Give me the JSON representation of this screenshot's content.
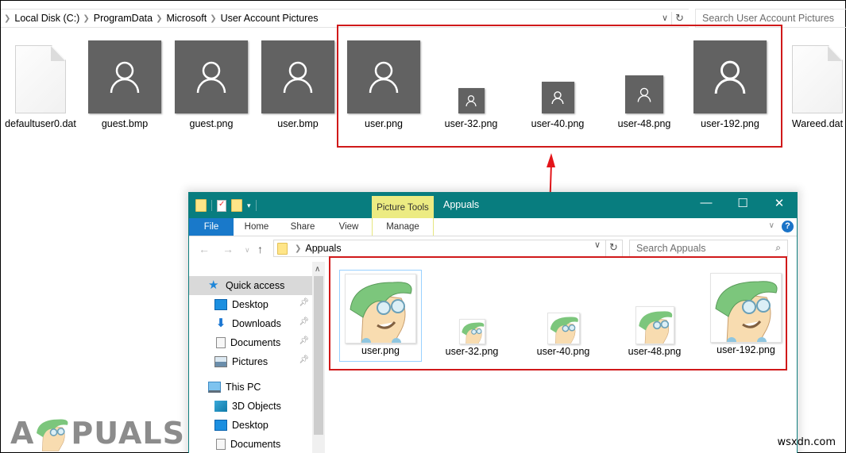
{
  "background_explorer": {
    "breadcrumb": [
      "Local Disk (C:)",
      "ProgramData",
      "Microsoft",
      "User Account Pictures"
    ],
    "search_placeholder": "Search User Account Pictures",
    "files": [
      {
        "name": "defaultuser0.dat",
        "type": "document"
      },
      {
        "name": "guest.bmp",
        "type": "avatar"
      },
      {
        "name": "guest.png",
        "type": "avatar"
      },
      {
        "name": "user.bmp",
        "type": "avatar"
      },
      {
        "name": "user.png",
        "type": "avatar"
      },
      {
        "name": "user-32.png",
        "type": "avatar"
      },
      {
        "name": "user-40.png",
        "type": "avatar"
      },
      {
        "name": "user-48.png",
        "type": "avatar"
      },
      {
        "name": "user-192.png",
        "type": "avatar"
      },
      {
        "name": "Wareed.dat",
        "type": "document"
      }
    ]
  },
  "window": {
    "title": "Appuals",
    "contextual_tab_group": "Picture Tools",
    "ribbon_tabs": [
      "File",
      "Home",
      "Share",
      "View",
      "Manage"
    ],
    "address": [
      "Appuals"
    ],
    "search_placeholder": "Search Appuals",
    "sidebar": {
      "quick_access": "Quick access",
      "quick_items": [
        {
          "label": "Desktop",
          "icon": "desktop-icon",
          "pinned": true
        },
        {
          "label": "Downloads",
          "icon": "downloads-icon",
          "pinned": true
        },
        {
          "label": "Documents",
          "icon": "documents-icon",
          "pinned": true
        },
        {
          "label": "Pictures",
          "icon": "pictures-icon",
          "pinned": true
        }
      ],
      "this_pc": "This PC",
      "pc_items": [
        {
          "label": "3D Objects",
          "icon": "3d-objects-icon"
        },
        {
          "label": "Desktop",
          "icon": "desktop-icon"
        },
        {
          "label": "Documents",
          "icon": "documents-icon"
        }
      ]
    },
    "files": [
      {
        "name": "user.png",
        "selected": true
      },
      {
        "name": "user-32.png",
        "selected": false
      },
      {
        "name": "user-40.png",
        "selected": false
      },
      {
        "name": "user-48.png",
        "selected": false
      },
      {
        "name": "user-192.png",
        "selected": false
      }
    ]
  },
  "annotations": {
    "highlight_color": "#d0191a"
  },
  "watermark": {
    "brand": "PUALS",
    "brand_prefix": "A",
    "site": "wsxdn.com"
  },
  "colors": {
    "titlebar": "#087d7f",
    "file_tab": "#1979ca",
    "picture_tools": "#eceb82",
    "avatar_tile": "#626262"
  }
}
